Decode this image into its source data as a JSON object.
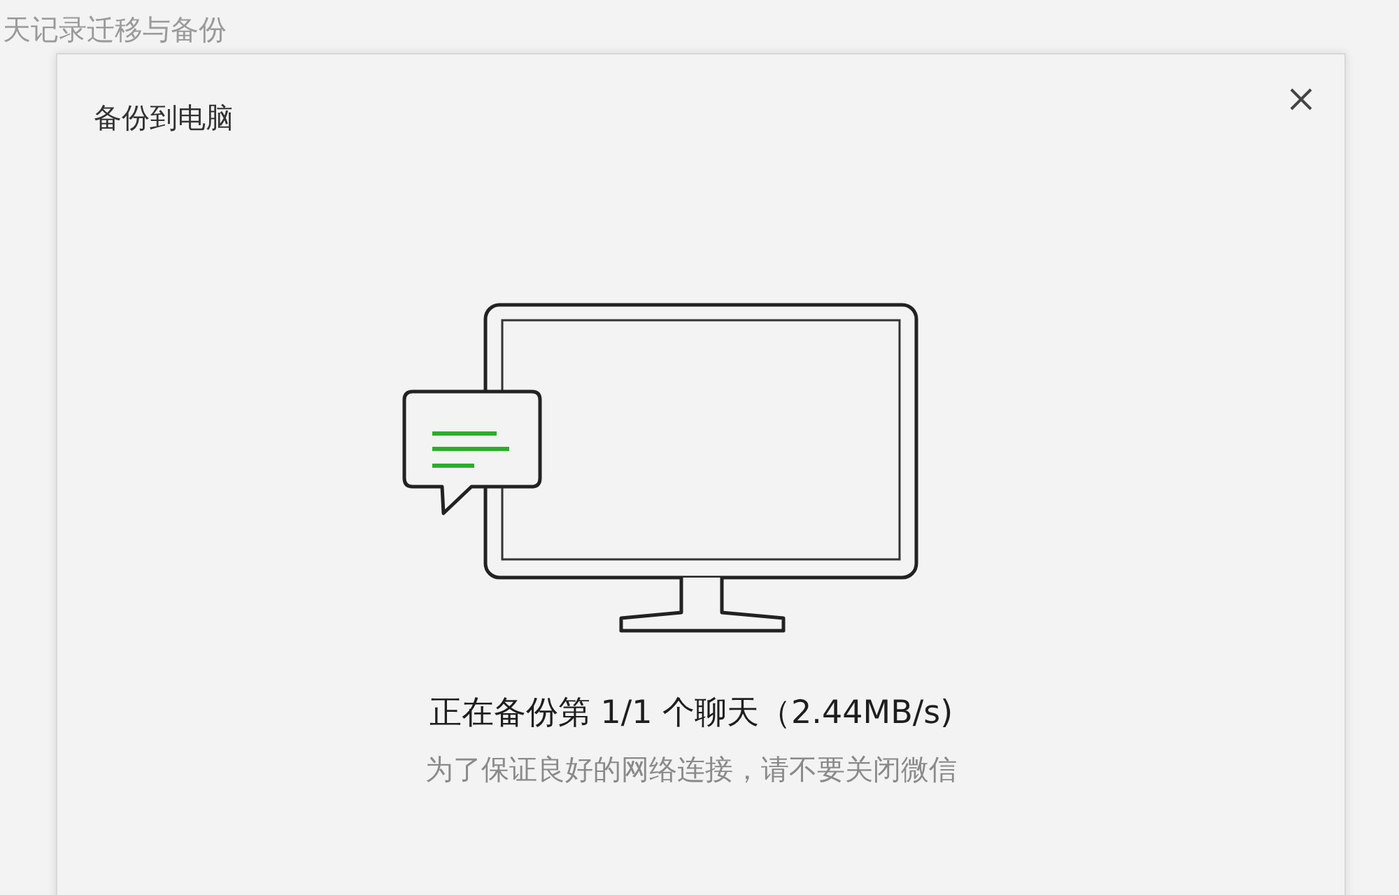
{
  "background_window": {
    "title": "天记录迁移与备份"
  },
  "dialog": {
    "title": "备份到电脑",
    "status": {
      "message": "正在备份第 1/1 个聊天（2.44MB/s)",
      "hint": "为了保证良好的网络连接，请不要关闭微信"
    }
  }
}
